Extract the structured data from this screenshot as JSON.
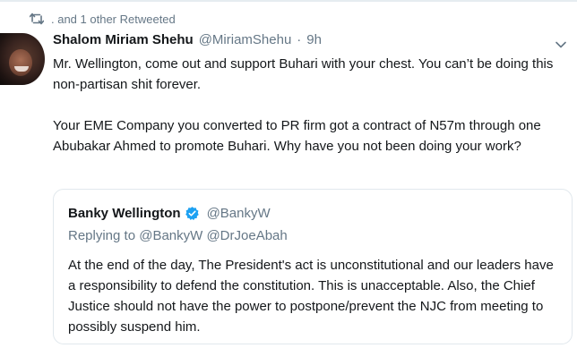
{
  "retweet_context": {
    "text": ". and 1 other Retweeted",
    "icon": "retweet-icon"
  },
  "tweet": {
    "display_name": "Shalom Miriam Shehu",
    "handle": "@MiriamShehu",
    "separator": "·",
    "time": "9h",
    "paragraph_1": "Mr. Wellington, come out and support Buhari with your chest. You can’t be doing this non-partisan shit forever.",
    "paragraph_2": "Your EME Company you converted to PR firm got a contract of N57m through one Abubakar Ahmed to promote Buhari. Why have you not been doing your work?"
  },
  "quoted_tweet": {
    "display_name": "Banky Wellington",
    "verified": true,
    "handle": "@BankyW",
    "replying_to": "Replying to @BankyW @DrJoeAbah",
    "text": "At the end of the day, The President's act is unconstitutional and our leaders have a responsibility to defend the constitution. This is unacceptable. Also, the Chief Justice should not have the power to postpone/prevent the NJC from meeting to possibly suspend him."
  },
  "colors": {
    "text_primary": "#14171a",
    "text_secondary": "#657786",
    "border": "#e1e8ed",
    "verified_blue": "#1da1f2"
  }
}
